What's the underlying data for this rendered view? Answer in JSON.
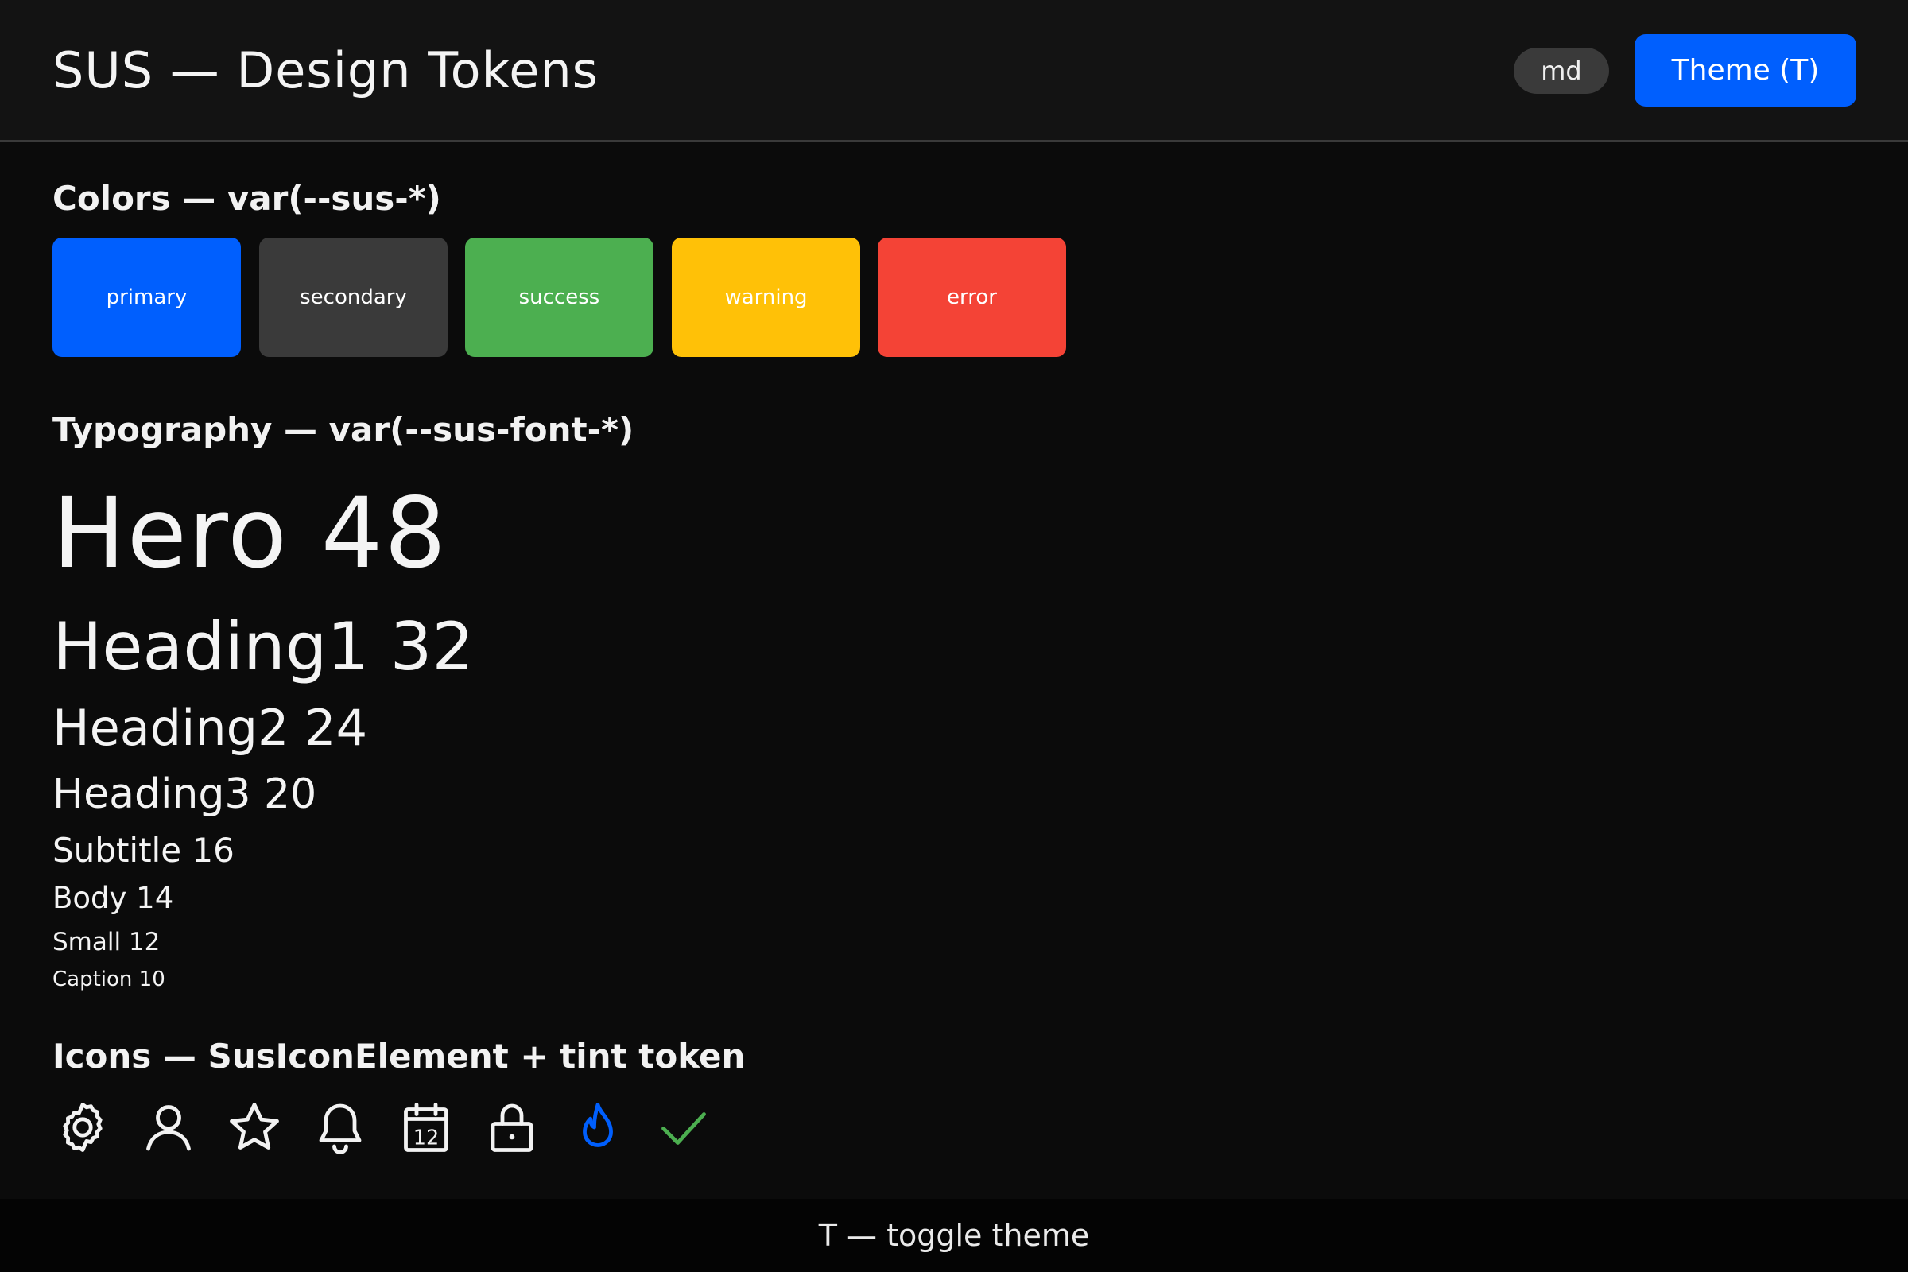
{
  "header": {
    "title": "SUS — Design Tokens",
    "size_chip": "md",
    "theme_button": "Theme (T)"
  },
  "colors_section": {
    "title": "Colors — var(--sus-*)",
    "swatches": [
      {
        "label": "primary",
        "color": "#005ffe"
      },
      {
        "label": "secondary",
        "color": "#3a3a3a"
      },
      {
        "label": "success",
        "color": "#4caf50"
      },
      {
        "label": "warning",
        "color": "#ffc107"
      },
      {
        "label": "error",
        "color": "#f44336"
      }
    ]
  },
  "typography_section": {
    "title": "Typography — var(--sus-font-*)",
    "samples": [
      {
        "label": "Hero 48"
      },
      {
        "label": "Heading1 32"
      },
      {
        "label": "Heading2 24"
      },
      {
        "label": "Heading3 20"
      },
      {
        "label": "Subtitle 16"
      },
      {
        "label": "Body 14"
      },
      {
        "label": "Small 12"
      },
      {
        "label": "Caption 10"
      }
    ]
  },
  "icons_section": {
    "title": "Icons — SusIconElement + tint token",
    "icons": [
      {
        "name": "gear-icon",
        "tint": "#f2f2f2"
      },
      {
        "name": "user-icon",
        "tint": "#f2f2f2"
      },
      {
        "name": "star-icon",
        "tint": "#f2f2f2"
      },
      {
        "name": "bell-icon",
        "tint": "#f2f2f2"
      },
      {
        "name": "calendar-icon",
        "tint": "#f2f2f2",
        "text": "12"
      },
      {
        "name": "lock-icon",
        "tint": "#f2f2f2"
      },
      {
        "name": "flame-icon",
        "tint": "#005ffe"
      },
      {
        "name": "checkmark-icon",
        "tint": "#4caf50"
      }
    ]
  },
  "footer": {
    "hint": "T — toggle theme"
  }
}
